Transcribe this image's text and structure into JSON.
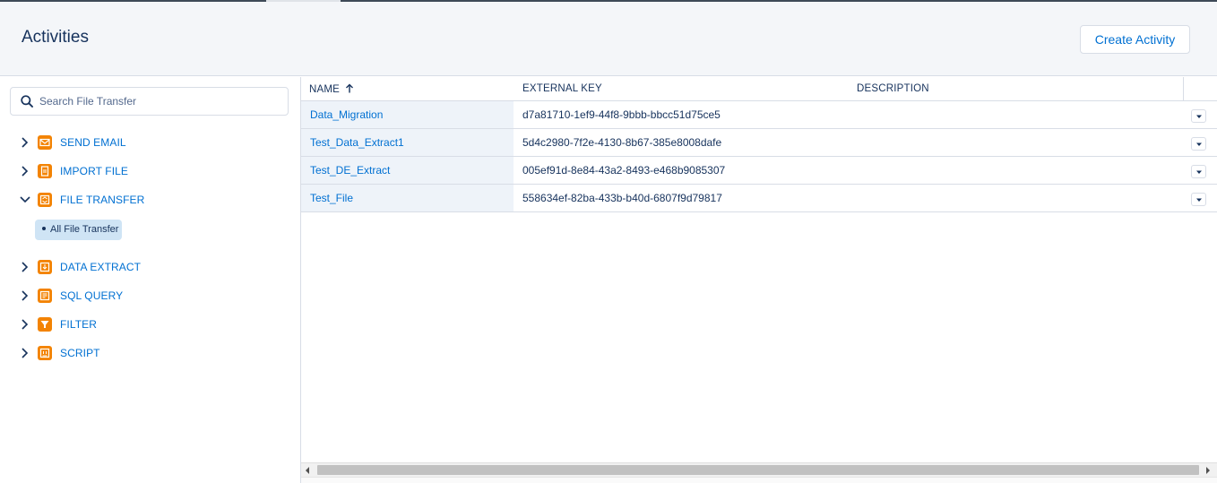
{
  "header": {
    "title": "Activities",
    "create_button": "Create Activity"
  },
  "search": {
    "placeholder": "Search File Transfer"
  },
  "sidebar": {
    "items": [
      {
        "label": "SEND EMAIL",
        "icon": "envelope-icon",
        "expanded": false
      },
      {
        "label": "IMPORT FILE",
        "icon": "document-icon",
        "expanded": false
      },
      {
        "label": "FILE TRANSFER",
        "icon": "file-transfer-icon",
        "expanded": true
      },
      {
        "label": "DATA EXTRACT",
        "icon": "data-extract-icon",
        "expanded": false
      },
      {
        "label": "SQL QUERY",
        "icon": "sql-query-icon",
        "expanded": false
      },
      {
        "label": "FILTER",
        "icon": "funnel-icon",
        "expanded": false
      },
      {
        "label": "SCRIPT",
        "icon": "script-icon",
        "expanded": false
      }
    ],
    "sub_item": "All File Transfer"
  },
  "table": {
    "columns": {
      "name": "NAME",
      "external_key": "EXTERNAL KEY",
      "description": "DESCRIPTION"
    },
    "sort": "ascending",
    "rows": [
      {
        "name": "Data_Migration",
        "external_key": "d7a81710-1ef9-44f8-9bbb-bbcc51d75ce5",
        "description": ""
      },
      {
        "name": "Test_Data_Extract1",
        "external_key": "5d4c2980-7f2e-4130-8b67-385e8008dafe",
        "description": ""
      },
      {
        "name": "Test_DE_Extract",
        "external_key": "005ef91d-8e84-43a2-8493-e468b9085307",
        "description": ""
      },
      {
        "name": "Test_File",
        "external_key": "558634ef-82ba-433b-b40d-6807f9d79817",
        "description": ""
      }
    ]
  },
  "colors": {
    "accent": "#0070d2",
    "icon": "#f38303",
    "text": "#16325c",
    "header_bg": "#f4f6f9",
    "selected_pill": "#cfe4f5"
  }
}
